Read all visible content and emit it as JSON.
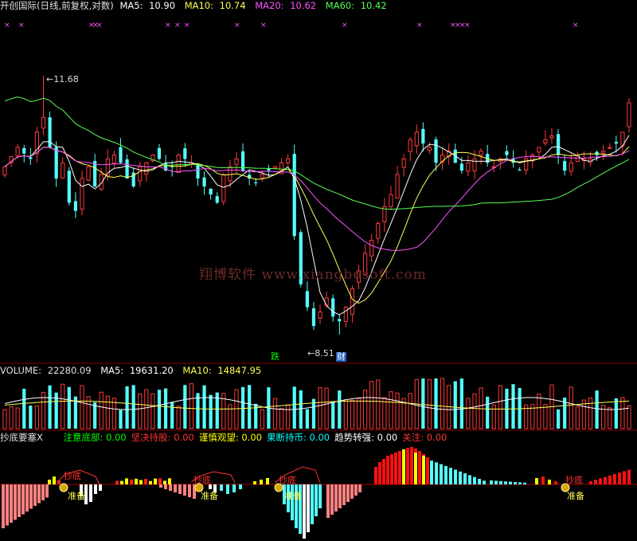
{
  "header": {
    "title": "开创国际(日线,前复权,对数)",
    "ma5_label": "MA5:",
    "ma5_value": "10.90",
    "ma10_label": "MA10:",
    "ma10_value": "10.74",
    "ma20_label": "MA20:",
    "ma20_value": "10.62",
    "ma60_label": "MA60:",
    "ma60_value": "10.42"
  },
  "price_panel": {
    "high_label": "11.68",
    "low_label": "8.51",
    "signal_die": "跌",
    "signal_cai": "财",
    "watermark": "翔博软件 www.xiangbosoft.com"
  },
  "volume_panel": {
    "vol_label": "VOLUME:",
    "vol_value": "22280.09",
    "ma5_label": "MA5:",
    "ma5_value": "19631.20",
    "ma10_label": "MA10:",
    "ma10_value": "14847.95"
  },
  "indicator_panel": {
    "name": "抄底要塞X",
    "items": [
      {
        "label": "注意底部:",
        "value": "0.00",
        "color": "#00ff00"
      },
      {
        "label": "坚决持股:",
        "value": "0.00",
        "color": "#ff3333"
      },
      {
        "label": "谨慎观望:",
        "value": "0.00",
        "color": "#ffff00"
      },
      {
        "label": "果断持币:",
        "value": "0.00",
        "color": "#00ffff"
      },
      {
        "label": "趋势转强:",
        "value": "0.00",
        "color": "#ffffff"
      },
      {
        "label": "关注:",
        "value": "0.00",
        "color": "#ff3333"
      }
    ],
    "marker_text_1": "抄底",
    "marker_text_2": "准备"
  },
  "colors": {
    "up": "#ff3b3b",
    "down": "#54ffff",
    "ma5": "#ffffff",
    "ma10": "#ffff54",
    "ma20": "#ff54ff",
    "ma60": "#54ff54",
    "grid": "#8b0000"
  },
  "chart_data": {
    "type": "candlestick",
    "title": "开创国际(日线,前复权,对数)",
    "y_scale": "log",
    "ylim": [
      8.51,
      11.68
    ],
    "annotated_high": 11.68,
    "annotated_low": 8.51,
    "close_series": [
      10.45,
      10.58,
      10.7,
      10.62,
      10.55,
      10.9,
      11.1,
      10.7,
      10.3,
      10.5,
      10.0,
      9.9,
      10.3,
      10.45,
      10.2,
      10.35,
      10.55,
      10.6,
      10.5,
      10.3,
      10.2,
      10.45,
      10.5,
      10.6,
      10.55,
      10.4,
      10.45,
      10.6,
      10.55,
      10.5,
      10.3,
      10.2,
      10.1,
      10.0,
      10.35,
      10.45,
      10.55,
      10.4,
      10.3,
      10.25,
      10.35,
      10.4,
      10.45,
      10.5,
      10.55,
      9.6,
      9.05,
      8.8,
      8.6,
      8.75,
      8.9,
      8.7,
      8.65,
      8.8,
      9.0,
      9.2,
      9.4,
      9.55,
      9.75,
      9.95,
      10.1,
      10.35,
      10.55,
      10.8,
      10.9,
      10.75,
      10.7,
      10.5,
      10.6,
      10.65,
      10.5,
      10.4,
      10.5,
      10.55,
      10.65,
      10.5,
      10.45,
      10.55,
      10.6,
      10.5,
      10.4,
      10.55,
      10.6,
      10.7,
      10.8,
      10.85,
      10.6,
      10.4,
      10.5,
      10.6,
      10.55,
      10.55,
      10.6,
      10.65,
      10.7,
      10.75,
      10.9,
      11.3
    ],
    "ma5": 10.9,
    "ma10": 10.74,
    "ma20": 10.62,
    "ma60": 10.42,
    "volume": 22280.09,
    "volume_ma5": 19631.2,
    "volume_ma10": 14847.95,
    "indicator": {
      "注意底部": 0.0,
      "坚决持股": 0.0,
      "谨慎观望": 0.0,
      "果断持币": 0.0,
      "趋势转强": 0.0,
      "关注": 0.0
    }
  }
}
